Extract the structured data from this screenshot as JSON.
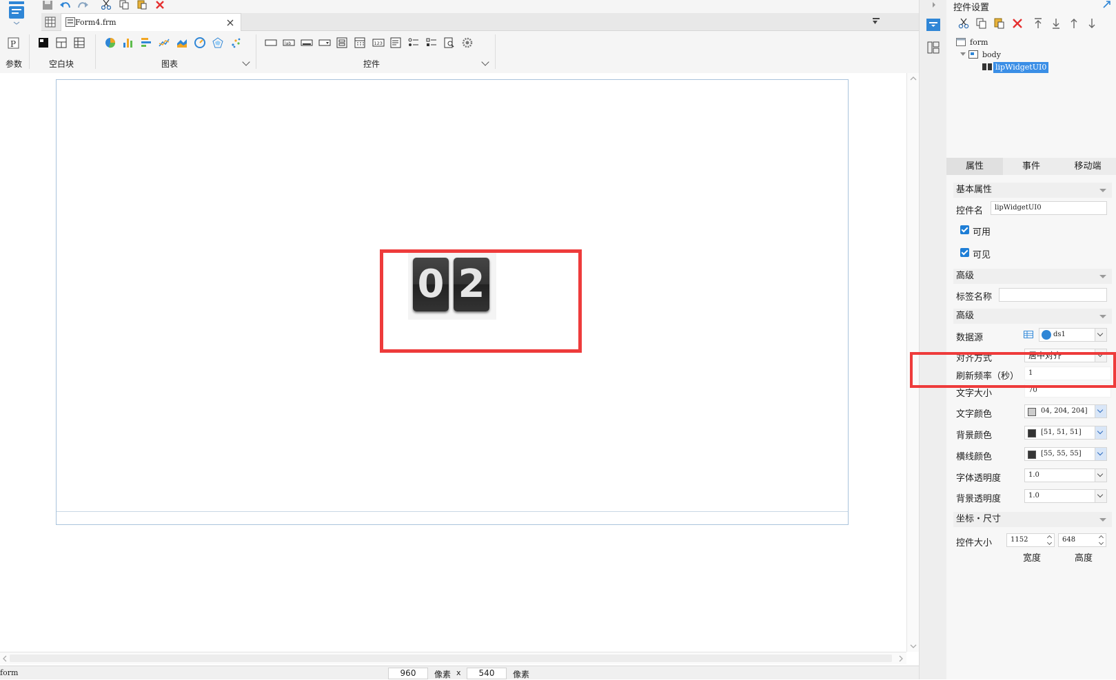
{
  "tab": {
    "filename": "Form4.frm"
  },
  "ribbon": {
    "groups": [
      {
        "label": "参数"
      },
      {
        "label": "空白块"
      },
      {
        "label": "图表"
      },
      {
        "label": "控件"
      }
    ]
  },
  "canvas": {
    "widget": {
      "digits": [
        "0",
        "2"
      ]
    }
  },
  "status": {
    "context": "form",
    "width_value": "960",
    "unit1": "像素",
    "times": "x",
    "height_value": "540",
    "unit2": "像素"
  },
  "panel": {
    "title": "控件设置",
    "tree": {
      "root": "form",
      "body": "body",
      "selected": "lipWidgetUI0"
    },
    "tabs": [
      "属性",
      "事件",
      "移动端"
    ],
    "sections": {
      "basic": "基本属性",
      "advanced1": "高级",
      "advanced2": "高级",
      "coords": "坐标・尺寸"
    },
    "fields": {
      "name_label": "控件名",
      "name_value": "lipWidgetUI0",
      "enabled_label": "可用",
      "visible_label": "可见",
      "tag_label": "标签名称",
      "tag_value": "",
      "datasource_label": "数据源",
      "datasource_value": "ds1",
      "align_label": "对齐方式",
      "align_value": "居中对齐",
      "refresh_label": "刷新频率（秒）",
      "refresh_value": "1",
      "fontsize_label": "文字大小",
      "fontsize_value": "70",
      "fontcolor_label": "文字颜色",
      "fontcolor_value": "04, 204, 204]",
      "fontcolor_swatch": "#cccccc",
      "bgcolor_label": "背景颜色",
      "bgcolor_value": "[51, 51, 51]",
      "bgcolor_swatch": "#333333",
      "linecolor_label": "横线颜色",
      "linecolor_value": "[55, 55, 55]",
      "linecolor_swatch": "#373737",
      "fontalpha_label": "字体透明度",
      "fontalpha_value": "1.0",
      "bgalpha_label": "背景透明度",
      "bgalpha_value": "1.0",
      "size_label": "控件大小",
      "size_width_value": "1152",
      "size_height_value": "648",
      "size_width_caption": "宽度",
      "size_height_caption": "高度"
    }
  },
  "colors": {
    "accent": "#1e7ed6",
    "highlight": "#ee3b3b",
    "selection": "#3a8ee6"
  }
}
